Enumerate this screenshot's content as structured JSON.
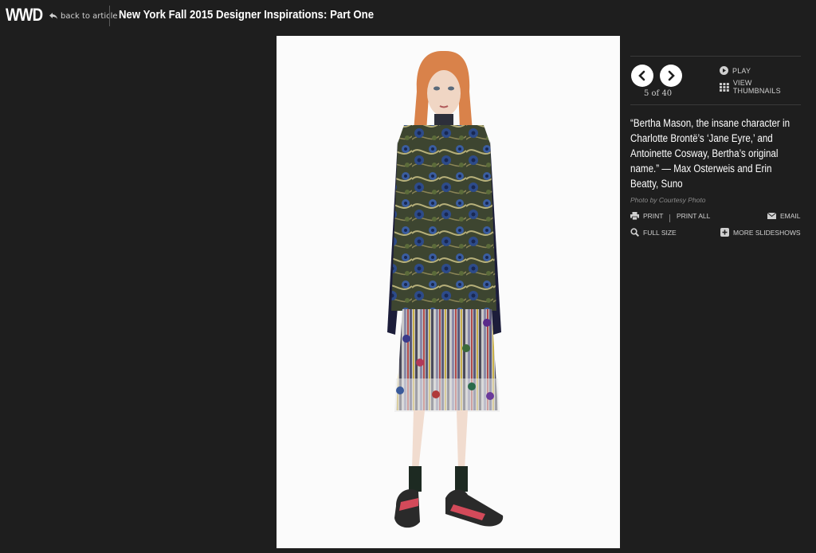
{
  "header": {
    "logo": "WWD",
    "back_label": "back to article",
    "title": "New York Fall 2015 Designer Inspirations: Part One"
  },
  "slideshow": {
    "counter": "5 of 40",
    "play_label": "PLAY",
    "thumbnails_label": "VIEW THUMBNAILS",
    "caption": "“Bertha Mason, the insane character in Charlotte Brontë’s ‘Jane Eyre,’ and Antoinette Cosway, Bertha’s original name.” — Max Osterweis and Erin Beatty, Suno",
    "credit": "Photo by Courtesy Photo"
  },
  "actions": {
    "print": "PRINT",
    "print_all": "PRINT ALL",
    "email": "EMAIL",
    "full_size": "FULL SIZE",
    "more_slideshows": "MORE SLIDESHOWS"
  },
  "icons": {
    "back": "back-arrow-icon",
    "prev": "chevron-left-icon",
    "next": "chevron-right-icon",
    "play": "play-icon",
    "thumbnails": "grid-icon",
    "print": "printer-icon",
    "email": "envelope-icon",
    "full_size": "magnifier-icon",
    "more": "plus-icon"
  },
  "colors": {
    "background": "#1e1e1e",
    "text": "#ffffff",
    "muted": "#8a8a8a"
  }
}
